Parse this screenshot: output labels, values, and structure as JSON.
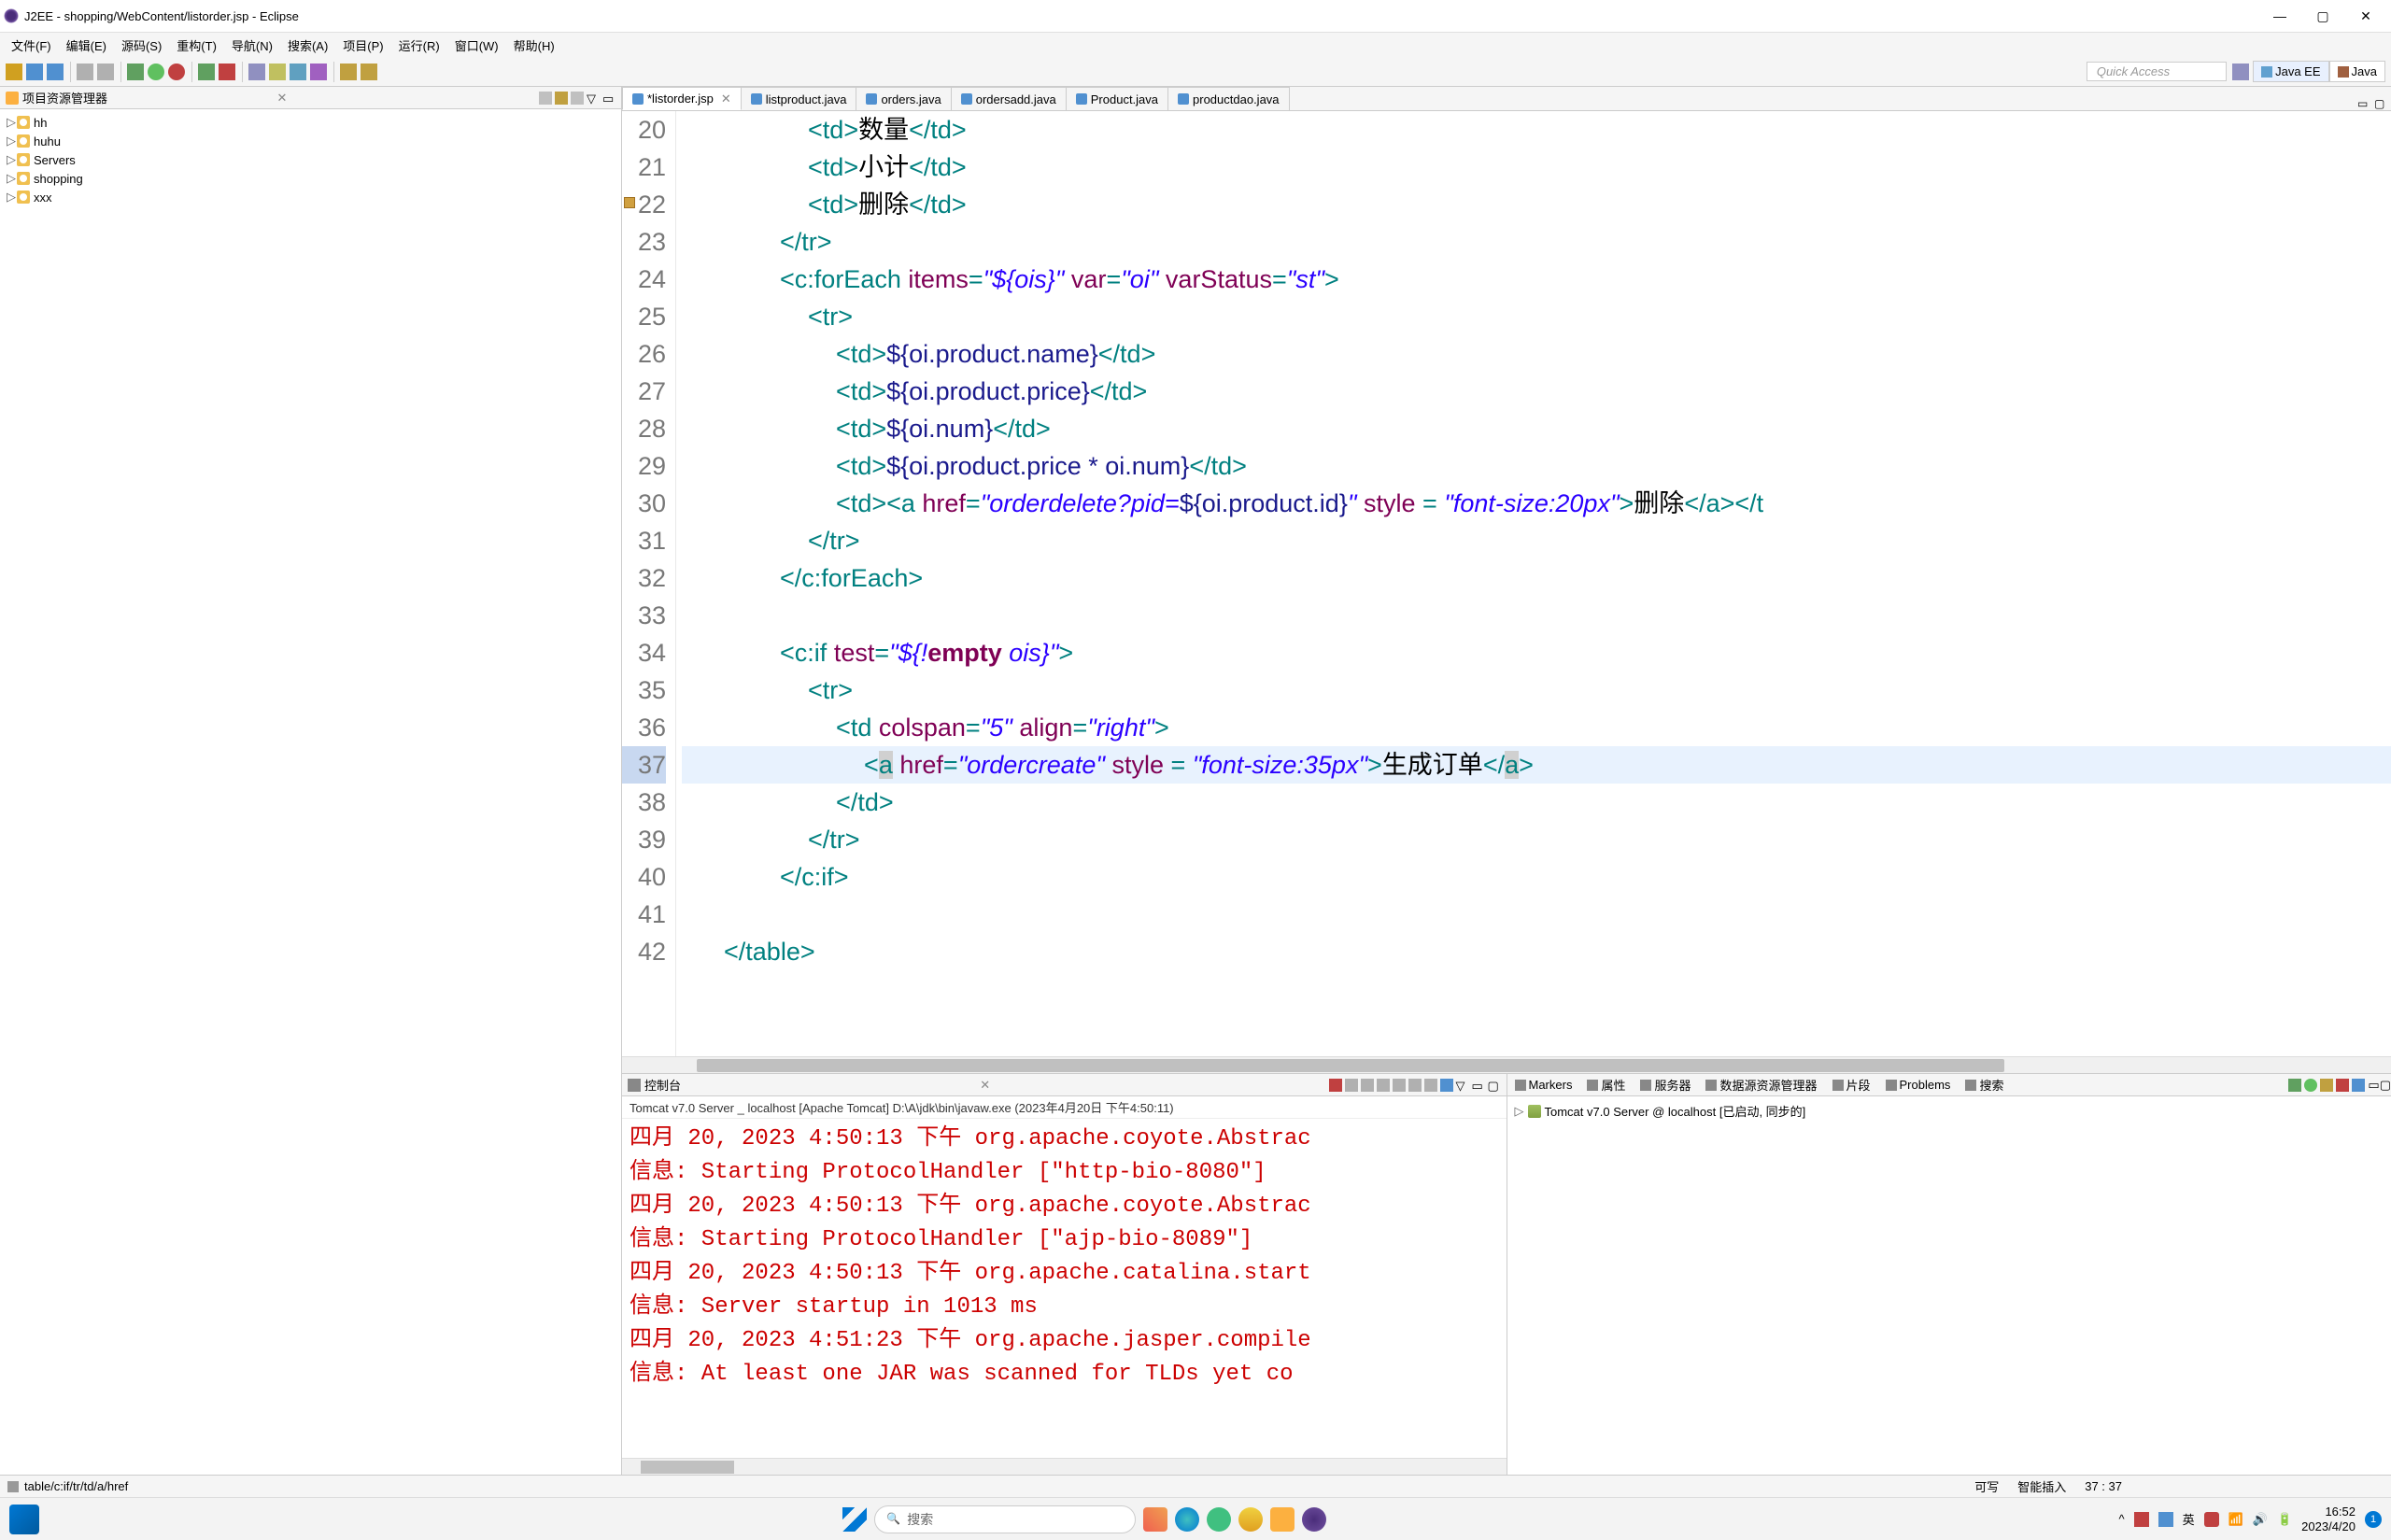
{
  "titlebar": {
    "title": "J2EE - shopping/WebContent/listorder.jsp - Eclipse"
  },
  "menu": [
    "文件(F)",
    "编辑(E)",
    "源码(S)",
    "重构(T)",
    "导航(N)",
    "搜索(A)",
    "项目(P)",
    "运行(R)",
    "窗口(W)",
    "帮助(H)"
  ],
  "quick_access": "Quick Access",
  "perspectives": {
    "java_ee": "Java EE",
    "java": "Java"
  },
  "project_explorer": {
    "title": "项目资源管理器",
    "items": [
      "hh",
      "huhu",
      "Servers",
      "shopping",
      "xxx"
    ]
  },
  "editor": {
    "tabs": [
      {
        "label": "*listorder.jsp",
        "active": true
      },
      {
        "label": "listproduct.java",
        "active": false
      },
      {
        "label": "orders.java",
        "active": false
      },
      {
        "label": "ordersadd.java",
        "active": false
      },
      {
        "label": "Product.java",
        "active": false
      },
      {
        "label": "productdao.java",
        "active": false
      }
    ],
    "first_line": 20,
    "current_line": 37,
    "code": [
      {
        "n": 20,
        "ind": 4,
        "tokens": [
          [
            "tag",
            "<td>"
          ],
          [
            "text",
            "数量"
          ],
          [
            "tag",
            "</td>"
          ]
        ]
      },
      {
        "n": 21,
        "ind": 4,
        "tokens": [
          [
            "tag",
            "<td>"
          ],
          [
            "text",
            "小计"
          ],
          [
            "tag",
            "</td>"
          ]
        ]
      },
      {
        "n": 22,
        "ind": 4,
        "tokens": [
          [
            "tag",
            "<td>"
          ],
          [
            "text",
            "删除"
          ],
          [
            "tag",
            "</td>"
          ]
        ]
      },
      {
        "n": 23,
        "ind": 3,
        "tokens": [
          [
            "tag",
            "</tr>"
          ]
        ]
      },
      {
        "n": 24,
        "ind": 3,
        "tokens": [
          [
            "tag",
            "<c:forEach "
          ],
          [
            "attr",
            "items"
          ],
          [
            "tag",
            "="
          ],
          [
            "str",
            "\"${ois}\""
          ],
          [
            "tag",
            " "
          ],
          [
            "attr",
            "var"
          ],
          [
            "tag",
            "="
          ],
          [
            "str",
            "\"oi\""
          ],
          [
            "tag",
            " "
          ],
          [
            "attr",
            "varStatus"
          ],
          [
            "tag",
            "="
          ],
          [
            "str",
            "\"st\""
          ],
          [
            "tag",
            ">"
          ]
        ]
      },
      {
        "n": 25,
        "ind": 4,
        "tokens": [
          [
            "tag",
            "<tr>"
          ]
        ]
      },
      {
        "n": 26,
        "ind": 5,
        "tokens": [
          [
            "tag",
            "<td>"
          ],
          [
            "el",
            "${oi.product.name}"
          ],
          [
            "tag",
            "</td>"
          ]
        ]
      },
      {
        "n": 27,
        "ind": 5,
        "tokens": [
          [
            "tag",
            "<td>"
          ],
          [
            "el",
            "${oi.product.price}"
          ],
          [
            "tag",
            "</td>"
          ]
        ]
      },
      {
        "n": 28,
        "ind": 5,
        "tokens": [
          [
            "tag",
            "<td>"
          ],
          [
            "el",
            "${oi.num}"
          ],
          [
            "tag",
            "</td>"
          ]
        ]
      },
      {
        "n": 29,
        "ind": 5,
        "tokens": [
          [
            "tag",
            "<td>"
          ],
          [
            "el",
            "${oi.product.price * oi.num}"
          ],
          [
            "tag",
            "</td>"
          ]
        ]
      },
      {
        "n": 30,
        "ind": 5,
        "tokens": [
          [
            "tag",
            "<td><a "
          ],
          [
            "attr",
            "href"
          ],
          [
            "tag",
            "="
          ],
          [
            "str",
            "\"orderdelete?pid="
          ],
          [
            "el",
            "${oi.product.id}"
          ],
          [
            "str",
            "\""
          ],
          [
            "tag",
            " "
          ],
          [
            "attr",
            "style"
          ],
          [
            "tag",
            " = "
          ],
          [
            "str",
            "\"font-size:20px\""
          ],
          [
            "tag",
            ">"
          ],
          [
            "text",
            "删除"
          ],
          [
            "tag",
            "</a></t"
          ]
        ]
      },
      {
        "n": 31,
        "ind": 4,
        "tokens": [
          [
            "tag",
            "</tr>"
          ]
        ]
      },
      {
        "n": 32,
        "ind": 3,
        "tokens": [
          [
            "tag",
            "</c:forEach>"
          ]
        ]
      },
      {
        "n": 33,
        "ind": 0,
        "tokens": []
      },
      {
        "n": 34,
        "ind": 3,
        "tokens": [
          [
            "tag",
            "<c:if "
          ],
          [
            "attr",
            "test"
          ],
          [
            "tag",
            "="
          ],
          [
            "str",
            "\"${!"
          ],
          [
            "kw",
            "empty"
          ],
          [
            "str",
            " ois}\""
          ],
          [
            "tag",
            ">"
          ]
        ]
      },
      {
        "n": 35,
        "ind": 4,
        "tokens": [
          [
            "tag",
            "<tr>"
          ]
        ]
      },
      {
        "n": 36,
        "ind": 5,
        "tokens": [
          [
            "tag",
            "<td "
          ],
          [
            "attr",
            "colspan"
          ],
          [
            "tag",
            "="
          ],
          [
            "str",
            "\"5\""
          ],
          [
            "tag",
            " "
          ],
          [
            "attr",
            "align"
          ],
          [
            "tag",
            "="
          ],
          [
            "str",
            "\"right\""
          ],
          [
            "tag",
            ">"
          ]
        ]
      },
      {
        "n": 37,
        "ind": 6,
        "current": true,
        "tokens": [
          [
            "tag",
            "<"
          ],
          [
            "err",
            "a"
          ],
          [
            "tag",
            " "
          ],
          [
            "attr",
            "href"
          ],
          [
            "tag",
            "="
          ],
          [
            "str",
            "\"ordercreate\""
          ],
          [
            "tag",
            " "
          ],
          [
            "attr",
            "style"
          ],
          [
            "tag",
            " = "
          ],
          [
            "str",
            "\"font-size:35px\""
          ],
          [
            "tag",
            ">"
          ],
          [
            "text",
            "生成订单"
          ],
          [
            "tag",
            "</"
          ],
          [
            "err",
            "a"
          ],
          [
            "tag",
            ">"
          ]
        ]
      },
      {
        "n": 38,
        "ind": 5,
        "tokens": [
          [
            "tag",
            "</td>"
          ]
        ]
      },
      {
        "n": 39,
        "ind": 4,
        "tokens": [
          [
            "tag",
            "</tr>"
          ]
        ]
      },
      {
        "n": 40,
        "ind": 3,
        "tokens": [
          [
            "tag",
            "</c:if>"
          ]
        ]
      },
      {
        "n": 41,
        "ind": 0,
        "tokens": []
      },
      {
        "n": 42,
        "ind": 1,
        "tokens": [
          [
            "tag",
            "</table>"
          ]
        ]
      }
    ]
  },
  "console": {
    "tab": "控制台",
    "subheader": "Tomcat v7.0 Server _ localhost [Apache Tomcat] D:\\A\\jdk\\bin\\javaw.exe  (2023年4月20日 下午4:50:11)",
    "lines": [
      "四月 20, 2023 4:50:13 下午 org.apache.coyote.Abstrac",
      "信息: Starting ProtocolHandler [\"http-bio-8080\"]",
      "四月 20, 2023 4:50:13 下午 org.apache.coyote.Abstrac",
      "信息: Starting ProtocolHandler [\"ajp-bio-8089\"]",
      "四月 20, 2023 4:50:13 下午 org.apache.catalina.start",
      "信息: Server startup in 1013 ms",
      "四月 20, 2023 4:51:23 下午 org.apache.jasper.compile",
      "信息: At least one JAR was scanned for TLDs yet co"
    ]
  },
  "servers_panel": {
    "tabs": [
      "Markers",
      "属性",
      "服务器",
      "数据源资源管理器",
      "片段",
      "Problems",
      "搜索"
    ],
    "server": "Tomcat v7.0 Server @ localhost  [已启动, 同步的]"
  },
  "statusbar": {
    "left": "table/c:if/tr/td/a/href",
    "writable": "可写",
    "insert": "智能插入",
    "pos": "37 : 37"
  },
  "taskbar": {
    "search_placeholder": "搜索",
    "time": "16:52",
    "date": "2023/4/20"
  }
}
